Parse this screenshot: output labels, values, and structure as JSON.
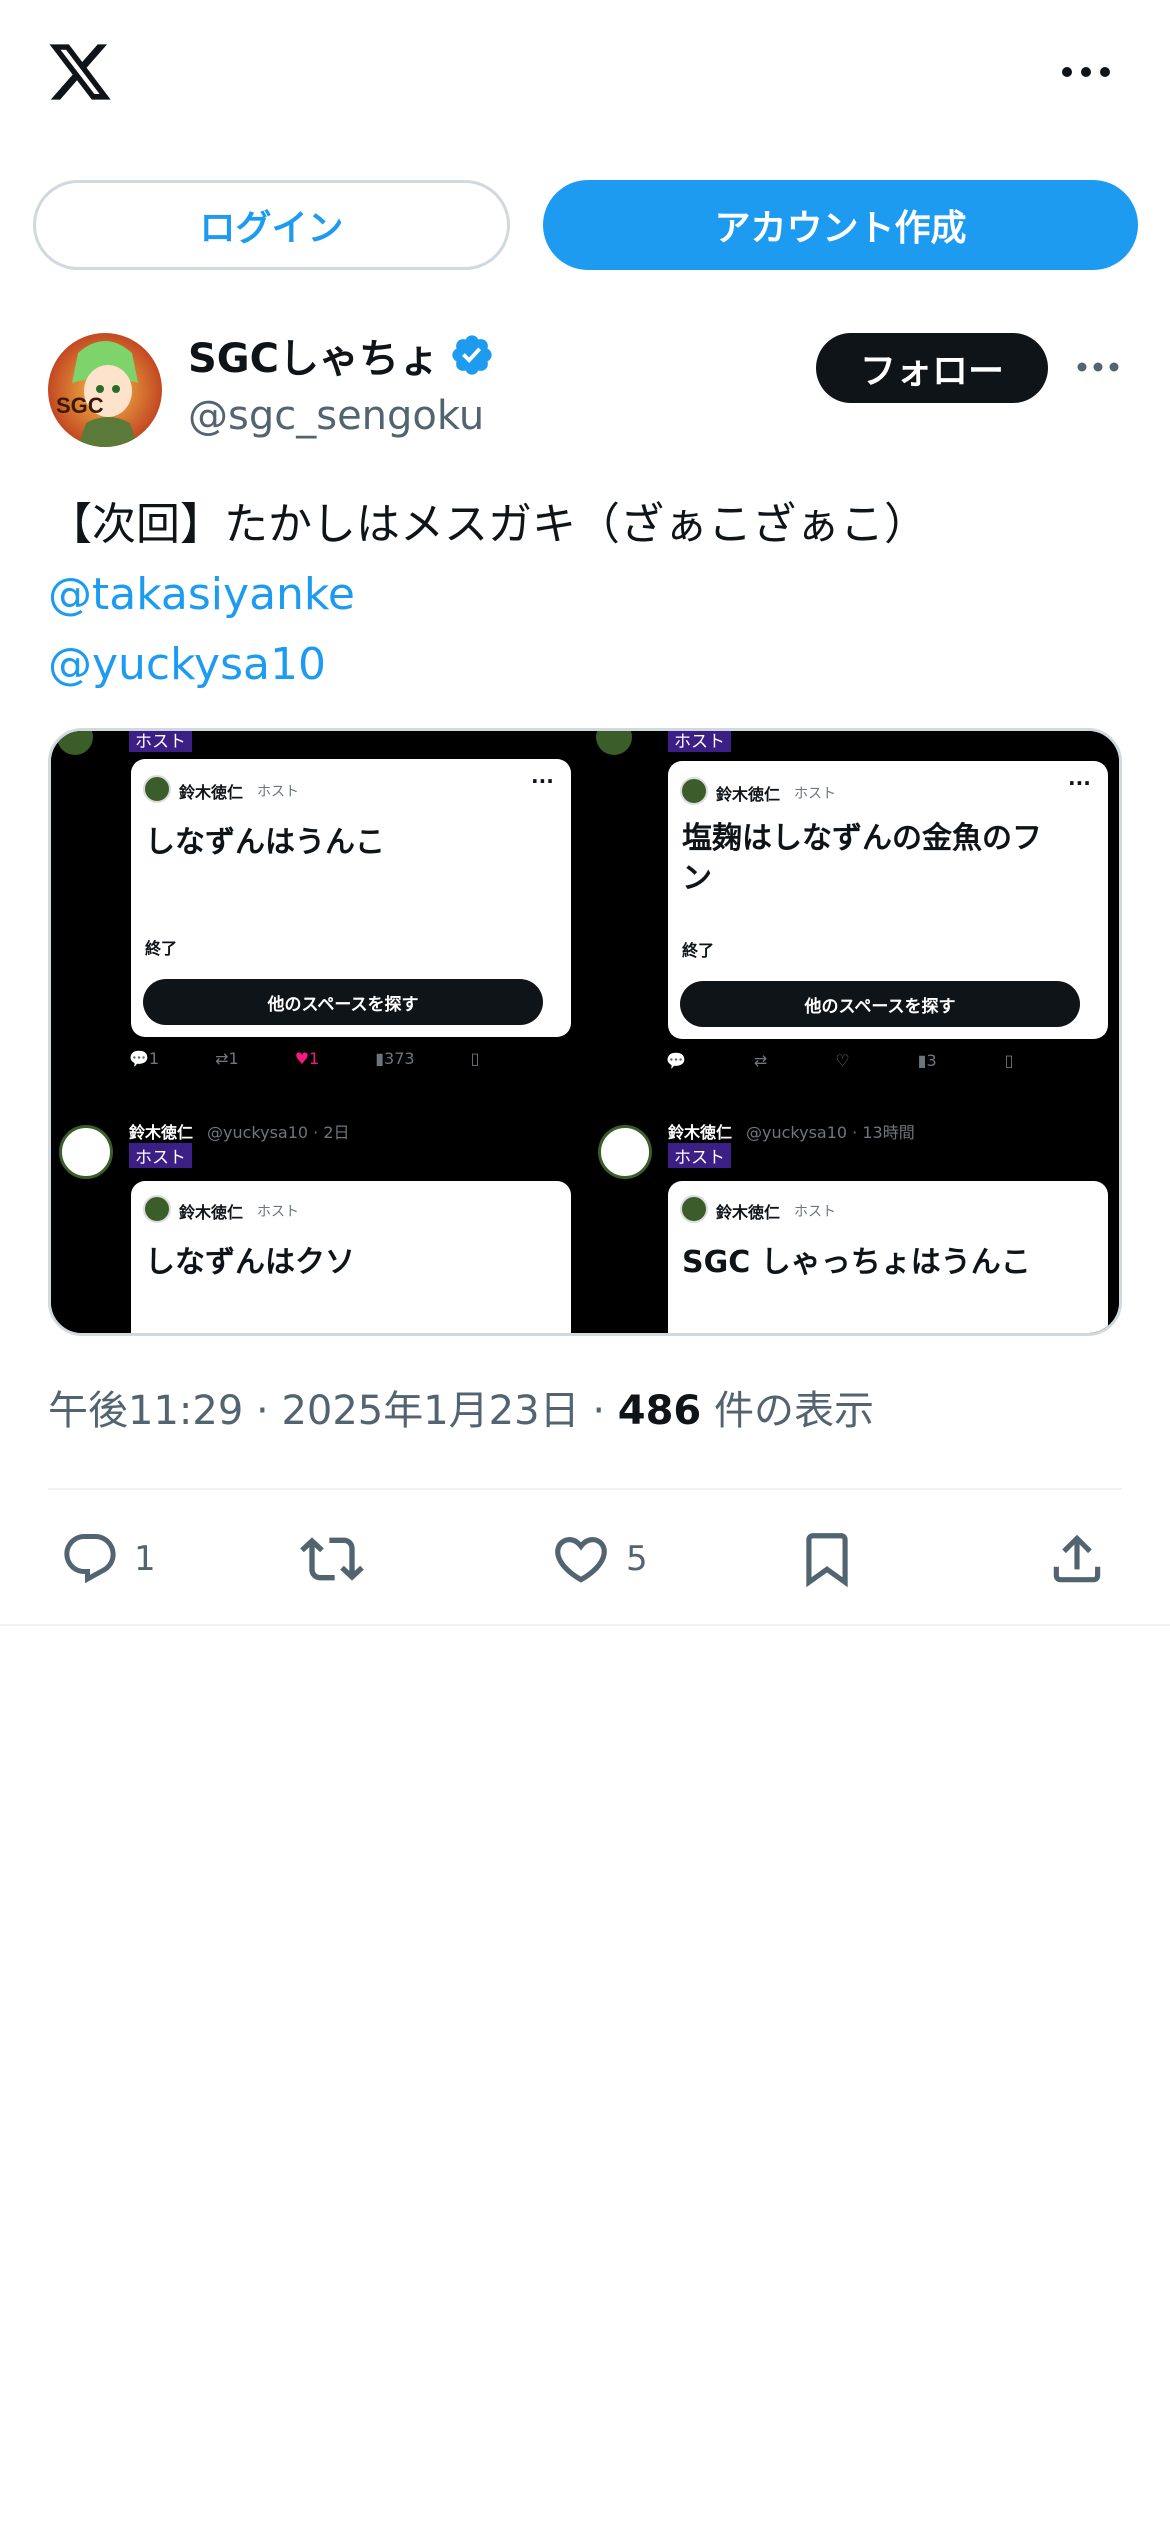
{
  "auth": {
    "login_label": "ログイン",
    "signup_label": "アカウント作成"
  },
  "author": {
    "display_name": "SGCしゃちょ",
    "handle": "@sgc_sengoku",
    "follow_label": "フォロー",
    "verified": true,
    "avatar_text": "SGC"
  },
  "tweet": {
    "text": "【次回】たかしはメスガキ（ざぁこざぁこ）",
    "mentions": [
      "@takasiyanke",
      "@yuckysa10"
    ]
  },
  "media": {
    "host_badge": "ホスト",
    "card_host_label": "ホスト",
    "card_user": "鈴木徳仁",
    "cells": [
      {
        "space_title": "しなずんはうんこ",
        "status": "終了",
        "button": "他のスペースを探す",
        "reply_count": "1",
        "retweet_count": "1",
        "like_count": "1",
        "view_count": "373"
      },
      {
        "space_title": "塩麹はしなずんの金魚のフン",
        "status": "終了",
        "button": "他のスペースを探す",
        "view_count": "3"
      },
      {
        "poster_name": "鈴木徳仁",
        "poster_meta": "@yuckysa10 · 2日",
        "space_title": "しなずんはクソ"
      },
      {
        "poster_name": "鈴木徳仁",
        "poster_meta": "@yuckysa10 · 13時間",
        "space_title": "SGC しゃっちょはうんこ"
      }
    ]
  },
  "meta": {
    "time": "午後11:29",
    "date": "2025年1月23日",
    "views": "486",
    "views_label": "件の表示",
    "sep": "·"
  },
  "actions": {
    "reply_count": "1",
    "like_count": "5"
  },
  "colors": {
    "accent": "#1d9bf0",
    "text": "#0f1419",
    "muted": "#536471",
    "like_pink": "#f91880",
    "host_purple": "#3b1f87"
  }
}
